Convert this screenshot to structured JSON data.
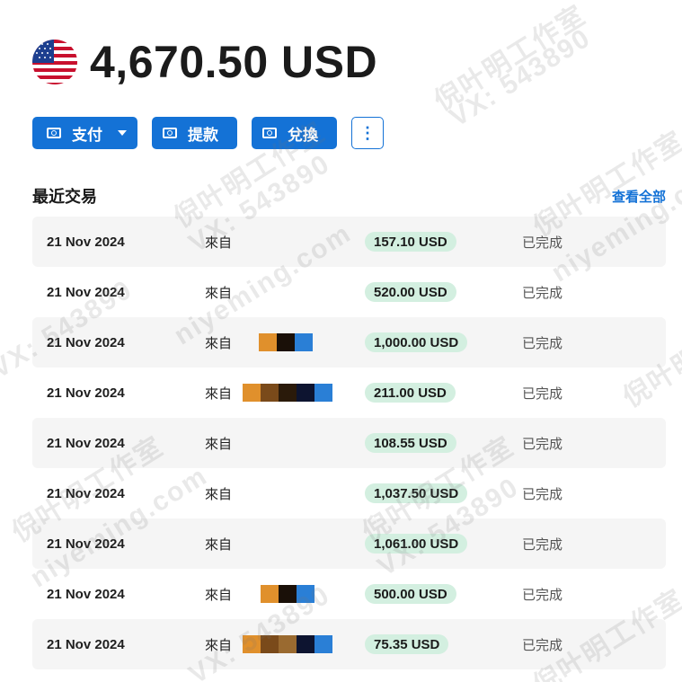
{
  "balance": {
    "amount_text": "4,670.50 USD",
    "flag_icon": "us-flag-icon"
  },
  "actions": {
    "pay_label": "支付",
    "withdraw_label": "提款",
    "exchange_label": "兌換",
    "more_label": "⋮"
  },
  "transactions": {
    "title": "最近交易",
    "view_all_label": "查看全部",
    "items": [
      {
        "date": "21 Nov 2024",
        "desc": "來自",
        "amount": "157.10 USD",
        "status": "已完成"
      },
      {
        "date": "21 Nov 2024",
        "desc": "來自",
        "amount": "520.00 USD",
        "status": "已完成"
      },
      {
        "date": "21 Nov 2024",
        "desc": "來自",
        "amount": "1,000.00 USD",
        "status": "已完成"
      },
      {
        "date": "21 Nov 2024",
        "desc": "來自",
        "amount": "211.00 USD",
        "status": "已完成"
      },
      {
        "date": "21 Nov 2024",
        "desc": "來自",
        "amount": "108.55 USD",
        "status": "已完成"
      },
      {
        "date": "21 Nov 2024",
        "desc": "來自",
        "amount": "1,037.50 USD",
        "status": "已完成"
      },
      {
        "date": "21 Nov 2024",
        "desc": "來自",
        "amount": "1,061.00 USD",
        "status": "已完成"
      },
      {
        "date": "21 Nov 2024",
        "desc": "來自",
        "amount": "500.00 USD",
        "status": "已完成"
      },
      {
        "date": "21 Nov 2024",
        "desc": "來自",
        "amount": "75.35 USD",
        "status": "已完成"
      }
    ]
  },
  "colors": {
    "accent": "#1472d6",
    "amount_pill": "#d3efe0",
    "row_shade": "#f5f5f5"
  },
  "watermark": {
    "line1": "倪叶明工作室",
    "line2": "VX: 543890",
    "line3": "niyeming.com"
  }
}
